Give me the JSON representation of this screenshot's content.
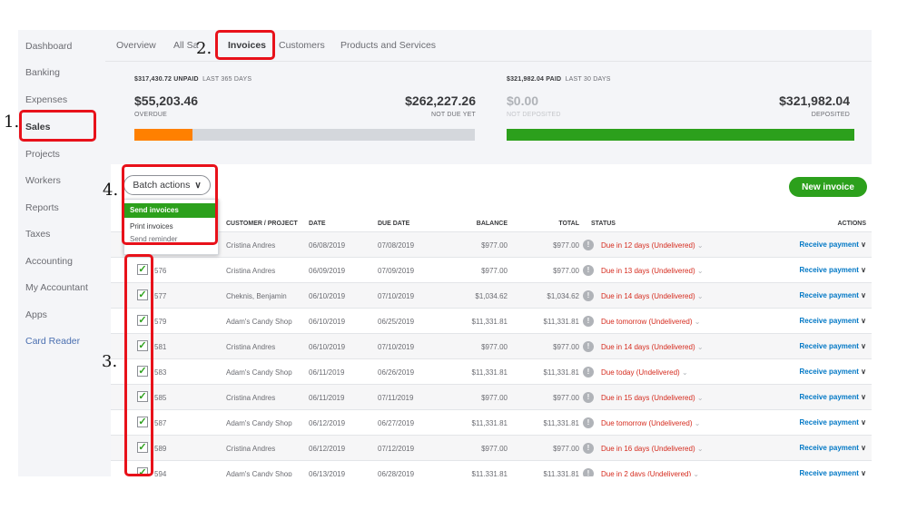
{
  "sidebar": {
    "items": [
      {
        "label": "Dashboard"
      },
      {
        "label": "Banking"
      },
      {
        "label": "Expenses"
      },
      {
        "label": "Sales"
      },
      {
        "label": "Projects"
      },
      {
        "label": "Workers"
      },
      {
        "label": "Reports"
      },
      {
        "label": "Taxes"
      },
      {
        "label": "Accounting"
      },
      {
        "label": "My Accountant"
      },
      {
        "label": "Apps"
      },
      {
        "label": "Card Reader"
      }
    ],
    "active": "Sales"
  },
  "tabs": [
    {
      "label": "Overview"
    },
    {
      "label": "All Sa"
    },
    {
      "label": "Invoices"
    },
    {
      "label": "Customers"
    },
    {
      "label": "Products and Services"
    }
  ],
  "summary": {
    "unpaid_amount": "$317,430.72 UNPAID",
    "unpaid_period": "LAST 365 DAYS",
    "overdue_amount": "$55,203.46",
    "overdue_label": "OVERDUE",
    "not_due_amount": "$262,227.26",
    "not_due_label": "NOT DUE YET",
    "paid_amount": "$321,982.04 PAID",
    "paid_period": "LAST 30 DAYS",
    "not_deposited_amount": "$0.00",
    "not_deposited_label": "NOT DEPOSITED",
    "deposited_amount": "$321,982.04",
    "deposited_label": "DEPOSITED",
    "overdue_fraction": 0.17,
    "deposited_fraction": 1.0,
    "colors": {
      "overdue": "#ff8000",
      "not_due": "#d4d7dc",
      "deposited": "#2ca01c"
    }
  },
  "toolbar": {
    "batch_label": "Batch actions",
    "new_invoice_label": "New invoice"
  },
  "batch_menu": {
    "items": [
      "Send invoices",
      "Print invoices",
      "Send reminder"
    ]
  },
  "table": {
    "headers": {
      "customer": "CUSTOMER / PROJECT",
      "date": "DATE",
      "due_date": "DUE DATE",
      "balance": "BALANCE",
      "total": "TOTAL",
      "status": "STATUS",
      "actions": "ACTIONS"
    },
    "rows": [
      {
        "no": "",
        "customer": "Cristina Andres",
        "date": "06/08/2019",
        "due": "07/08/2019",
        "balance": "$977.00",
        "total": "$977.00",
        "status": "Due in 12 days (Undelivered)",
        "action": "Receive payment",
        "checked": false
      },
      {
        "no": "576",
        "customer": "Cristina Andres",
        "date": "06/09/2019",
        "due": "07/09/2019",
        "balance": "$977.00",
        "total": "$977.00",
        "status": "Due in 13 days (Undelivered)",
        "action": "Receive payment",
        "checked": true
      },
      {
        "no": "577",
        "customer": "Cheknis, Benjamin",
        "date": "06/10/2019",
        "due": "07/10/2019",
        "balance": "$1,034.62",
        "total": "$1,034.62",
        "status": "Due in 14 days (Undelivered)",
        "action": "Receive payment",
        "checked": true
      },
      {
        "no": "579",
        "customer": "Adam's Candy Shop",
        "date": "06/10/2019",
        "due": "06/25/2019",
        "balance": "$11,331.81",
        "total": "$11,331.81",
        "status": "Due tomorrow (Undelivered)",
        "action": "Receive payment",
        "checked": true
      },
      {
        "no": "581",
        "customer": "Cristina Andres",
        "date": "06/10/2019",
        "due": "07/10/2019",
        "balance": "$977.00",
        "total": "$977.00",
        "status": "Due in 14 days (Undelivered)",
        "action": "Receive payment",
        "checked": true
      },
      {
        "no": "583",
        "customer": "Adam's Candy Shop",
        "date": "06/11/2019",
        "due": "06/26/2019",
        "balance": "$11,331.81",
        "total": "$11,331.81",
        "status": "Due today (Undelivered)",
        "action": "Receive payment",
        "checked": true
      },
      {
        "no": "585",
        "customer": "Cristina Andres",
        "date": "06/11/2019",
        "due": "07/11/2019",
        "balance": "$977.00",
        "total": "$977.00",
        "status": "Due in 15 days (Undelivered)",
        "action": "Receive payment",
        "checked": true
      },
      {
        "no": "587",
        "customer": "Adam's Candy Shop",
        "date": "06/12/2019",
        "due": "06/27/2019",
        "balance": "$11,331.81",
        "total": "$11,331.81",
        "status": "Due tomorrow (Undelivered)",
        "action": "Receive payment",
        "checked": true
      },
      {
        "no": "589",
        "customer": "Cristina Andres",
        "date": "06/12/2019",
        "due": "07/12/2019",
        "balance": "$977.00",
        "total": "$977.00",
        "status": "Due in 16 days (Undelivered)",
        "action": "Receive payment",
        "checked": true
      },
      {
        "no": "594",
        "customer": "Adam's Candy Shop",
        "date": "06/13/2019",
        "due": "06/28/2019",
        "balance": "$11,331.81",
        "total": "$11,331.81",
        "status": "Due in 2 days (Undelivered)",
        "action": "Receive payment",
        "checked": true
      }
    ]
  },
  "annotations": {
    "n1": "1.",
    "n2": "2.",
    "n3": "3.",
    "n4": "4.",
    "color": "#e8111a"
  },
  "icons": {
    "check": "✓",
    "chevron": "⌄",
    "chevron_bold": "∨",
    "info": "!"
  }
}
